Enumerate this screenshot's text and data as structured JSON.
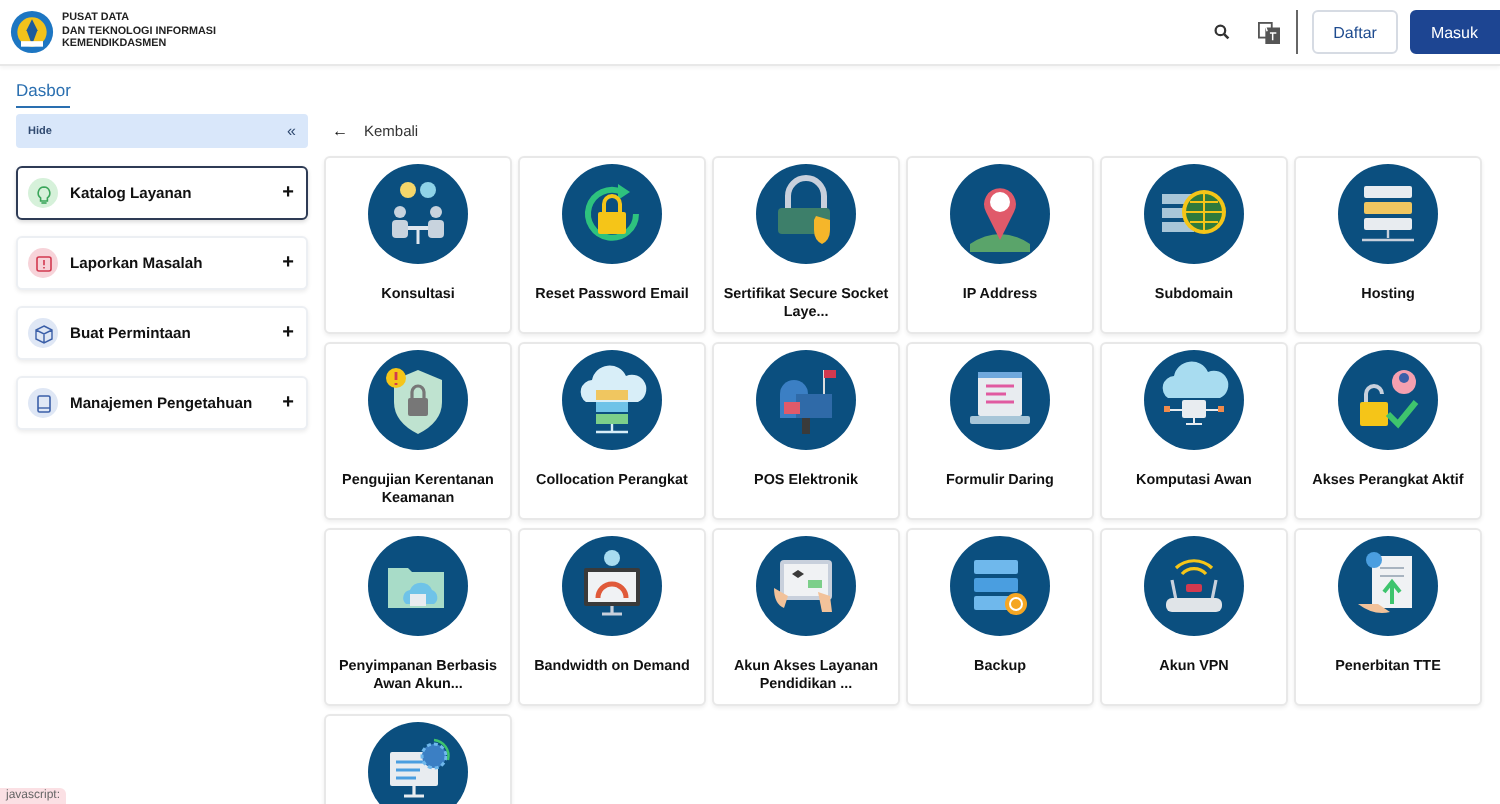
{
  "header": {
    "logo_lines": [
      "PUSAT DATA",
      "DAN TEKNOLOGI INFORMASI",
      "KEMENDIKDASMEN"
    ],
    "buttons": [
      {
        "label": "Daftar",
        "kind": "outline"
      },
      {
        "label": "Masuk",
        "kind": "primary"
      }
    ]
  },
  "tabs": [
    {
      "label": "Dasbor",
      "selected": true
    }
  ],
  "sidebar": {
    "toggle": {
      "label": "Hide",
      "icon": "«"
    },
    "items": [
      {
        "label": "Katalog Layanan",
        "kind": "bulb",
        "color": "#d6f1da",
        "selected": true,
        "action": "+"
      },
      {
        "label": "Laporkan Masalah",
        "kind": "alert",
        "color": "#f7d3d9",
        "selected": false,
        "action": "+"
      },
      {
        "label": "Buat Permintaan",
        "kind": "box",
        "color": "#dfe7f5",
        "selected": false,
        "action": "+"
      },
      {
        "label": "Manajemen Pengetahuan",
        "kind": "book",
        "color": "#dfe7f5",
        "selected": false,
        "action": "+"
      }
    ]
  },
  "back_link": {
    "icon": "←",
    "label": "Kembali"
  },
  "services": [
    {
      "label": "Konsultasi",
      "kind": "meeting"
    },
    {
      "label": "Reset Password Email",
      "kind": "reset"
    },
    {
      "label": "Sertifikat Secure Socket Laye...",
      "kind": "ssl"
    },
    {
      "label": "IP Address",
      "kind": "pin"
    },
    {
      "label": "Subdomain",
      "kind": "globe"
    },
    {
      "label": "Hosting",
      "kind": "server"
    },
    {
      "label": "Pengujian Kerentanan Keamanan",
      "kind": "shield"
    },
    {
      "label": "Collocation Perangkat",
      "kind": "cloudserver"
    },
    {
      "label": "POS Elektronik",
      "kind": "mailbox"
    },
    {
      "label": "Formulir Daring",
      "kind": "form"
    },
    {
      "label": "Komputasi Awan",
      "kind": "cloudpc"
    },
    {
      "label": "Akses Perangkat Aktif",
      "kind": "userlock"
    },
    {
      "label": "Penyimpanan Berbasis Awan Akun...",
      "kind": "folder"
    },
    {
      "label": "Bandwidth on Demand",
      "kind": "gauge"
    },
    {
      "label": "Akun Akses Layanan Pendidikan ...",
      "kind": "tablet"
    },
    {
      "label": "Backup",
      "kind": "database"
    },
    {
      "label": "Akun VPN",
      "kind": "router"
    },
    {
      "label": "Penerbitan TTE",
      "kind": "document"
    },
    {
      "kind": "gear"
    }
  ],
  "status_link": "javascript:"
}
